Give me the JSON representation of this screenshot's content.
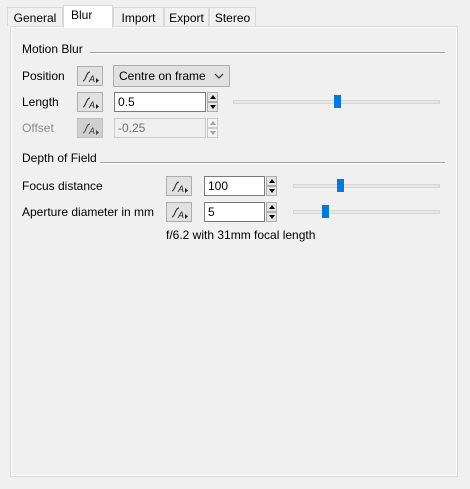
{
  "tabs": [
    "General",
    "Blur",
    "Import",
    "Export",
    "Stereo"
  ],
  "active_tab": "Blur",
  "motion_blur": {
    "title": "Motion Blur",
    "position": {
      "label": "Position",
      "value": "Centre on frame"
    },
    "length": {
      "label": "Length",
      "value": "0.5",
      "slider_fraction": 0.5
    },
    "offset": {
      "label": "Offset",
      "value": "-0.25"
    }
  },
  "depth_of_field": {
    "title": "Depth of Field",
    "focus_distance": {
      "label": "Focus distance",
      "value": "100",
      "slider_fraction": 0.32
    },
    "aperture": {
      "label": "Aperture diameter in mm",
      "value": "5",
      "slider_fraction": 0.22
    },
    "info": "f/6.2 with 31mm focal length"
  },
  "icons": {
    "animation": "animation-curve-icon",
    "dropdown": "chevron-down-icon",
    "spin_up": "spin-up-arrow-icon",
    "spin_down": "spin-down-arrow-icon"
  },
  "colors": {
    "slider_thumb": "#007ad9",
    "disabled_text": "#8c8c8c"
  }
}
